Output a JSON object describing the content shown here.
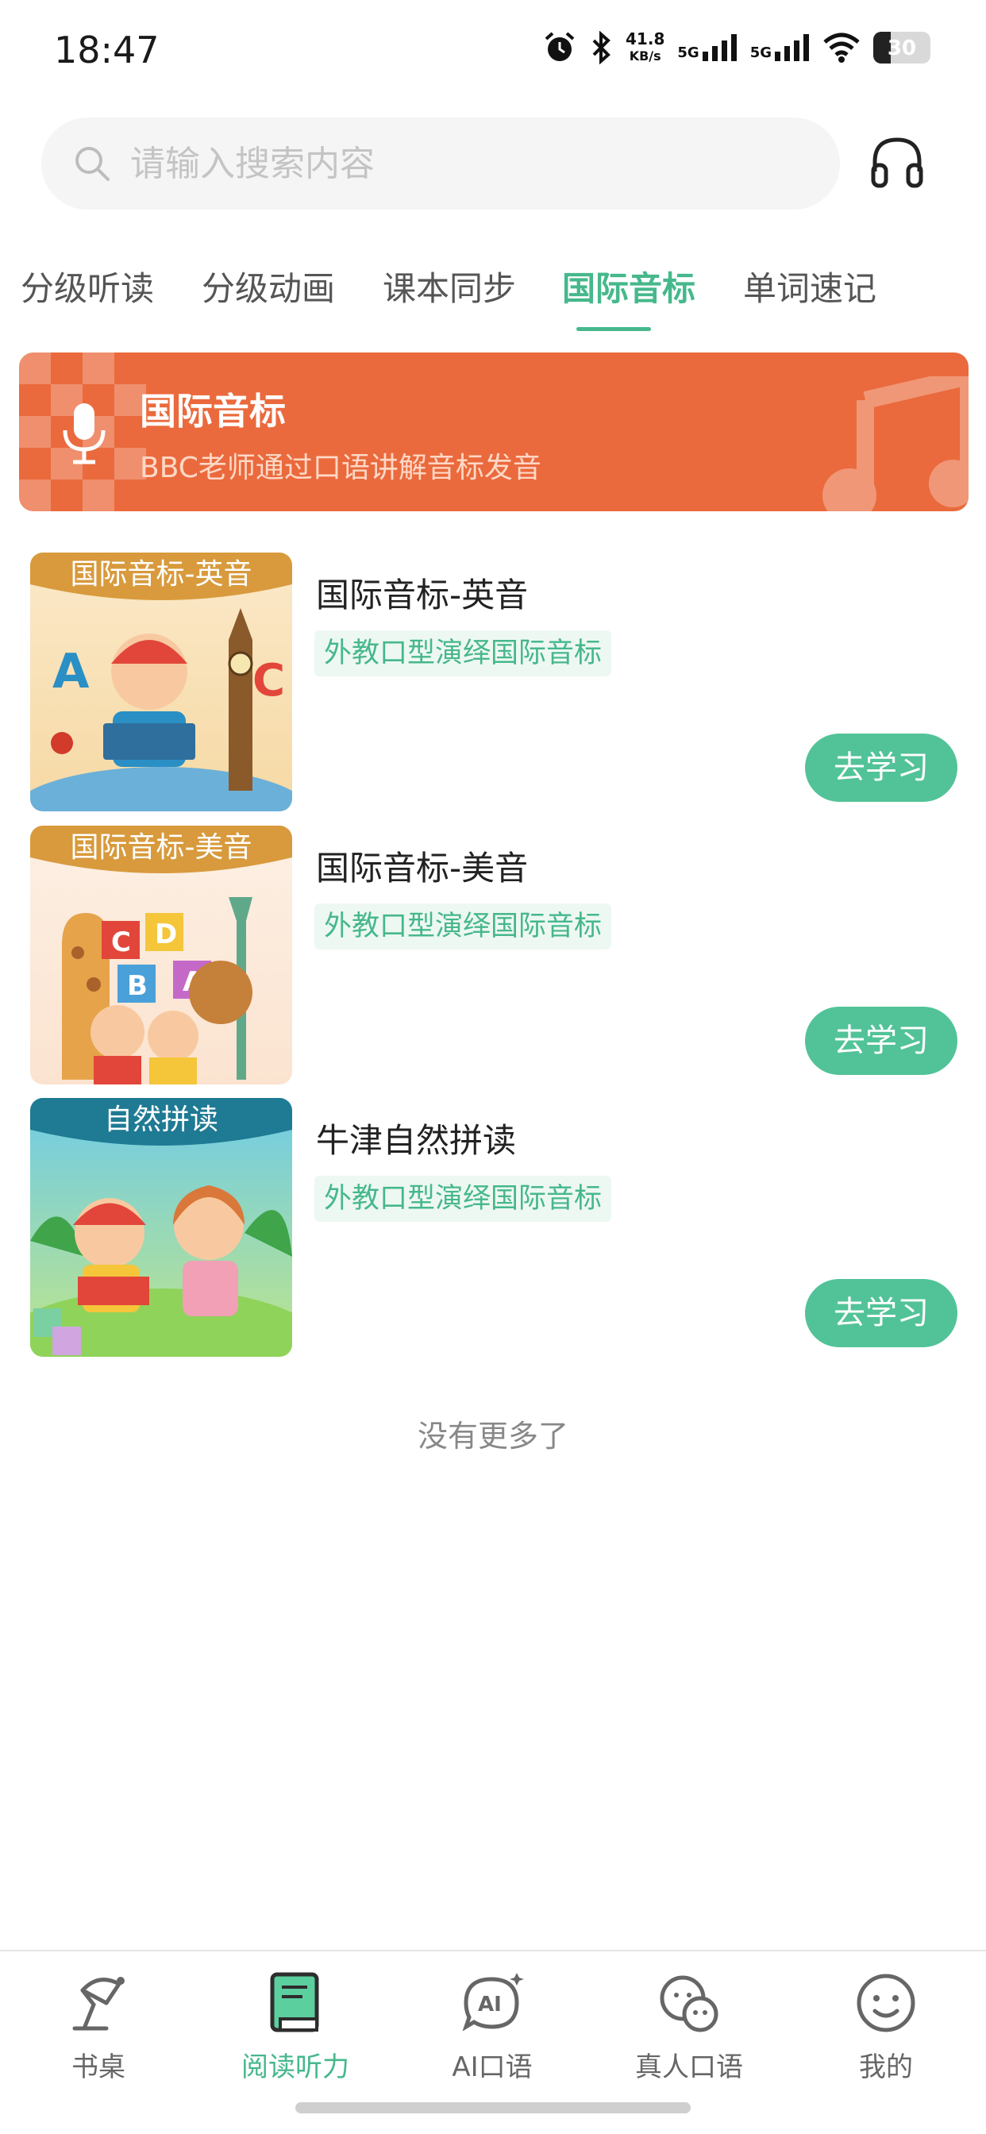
{
  "status_bar": {
    "time": "18:47",
    "net_speed_value": "41.8",
    "net_speed_unit": "KB/s",
    "signal_1": "5G",
    "signal_2": "5G",
    "battery": "30"
  },
  "search": {
    "placeholder": "请输入搜索内容"
  },
  "tabs": [
    {
      "label": "分级听读",
      "active": false
    },
    {
      "label": "分级动画",
      "active": false
    },
    {
      "label": "课本同步",
      "active": false
    },
    {
      "label": "国际音标",
      "active": true
    },
    {
      "label": "单词速记",
      "active": false
    }
  ],
  "banner": {
    "title": "国际音标",
    "subtitle": "BBC老师通过口语讲解音标发音"
  },
  "items": [
    {
      "thumb_title": "国际音标-英音",
      "title": "国际音标-英音",
      "tag": "外教口型演绎国际音标",
      "button": "去学习"
    },
    {
      "thumb_title": "国际音标-美音",
      "title": "国际音标-美音",
      "tag": "外教口型演绎国际音标",
      "button": "去学习"
    },
    {
      "thumb_title": "自然拼读",
      "title": "牛津自然拼读",
      "tag": "外教口型演绎国际音标",
      "button": "去学习"
    }
  ],
  "footer_text": "没有更多了",
  "bottom_nav": [
    {
      "label": "书桌",
      "icon": "desk-lamp-icon",
      "active": false
    },
    {
      "label": "阅读听力",
      "icon": "book-icon",
      "active": true
    },
    {
      "label": "AI口语",
      "icon": "ai-chat-icon",
      "active": false
    },
    {
      "label": "真人口语",
      "icon": "people-chat-icon",
      "active": false
    },
    {
      "label": "我的",
      "icon": "smiley-icon",
      "active": false
    }
  ],
  "colors": {
    "accent": "#46b88c",
    "banner": "#ea6a3d",
    "button": "#52c398"
  }
}
